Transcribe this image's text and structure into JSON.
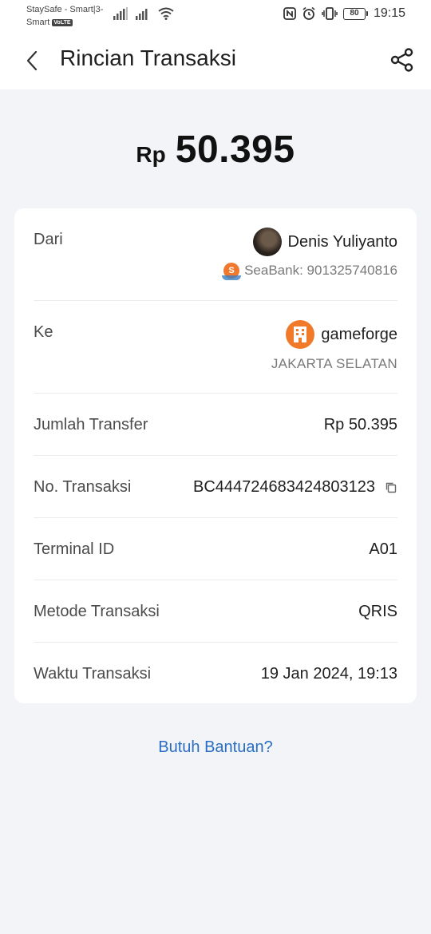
{
  "status_bar": {
    "carrier_line1": "StaySafe - Smart|3-",
    "carrier_line2": "Smart",
    "volte": "VoLTE",
    "battery": "80",
    "time": "19:15"
  },
  "header": {
    "title": "Rincian Transaksi"
  },
  "amount": {
    "currency": "Rp",
    "value": "50.395"
  },
  "details": {
    "from": {
      "label": "Dari",
      "name": "Denis Yuliyanto",
      "bank": "SeaBank: 901325740816"
    },
    "to": {
      "label": "Ke",
      "name": "gameforge",
      "city": "JAKARTA SELATAN"
    },
    "transfer_amount": {
      "label": "Jumlah Transfer",
      "value": "Rp 50.395"
    },
    "transaction_no": {
      "label": "No. Transaksi",
      "value": "BC444724683424803123"
    },
    "terminal_id": {
      "label": "Terminal ID",
      "value": "A01"
    },
    "method": {
      "label": "Metode Transaksi",
      "value": "QRIS"
    },
    "time": {
      "label": "Waktu Transaksi",
      "value": "19 Jan 2024, 19:13"
    }
  },
  "help": {
    "label": "Butuh Bantuan?"
  },
  "colors": {
    "background": "#f3f4f8",
    "card": "#ffffff",
    "link": "#2a6ec3",
    "merchant_logo": "#f07a2a",
    "muted_text": "#7a7a7a"
  },
  "icons": [
    "back-arrow-icon",
    "share-icon",
    "copy-icon",
    "seabank-logo-icon",
    "merchant-building-icon",
    "signal-icon",
    "wifi-icon",
    "nfc-icon",
    "alarm-icon",
    "vibrate-icon",
    "battery-icon"
  ]
}
